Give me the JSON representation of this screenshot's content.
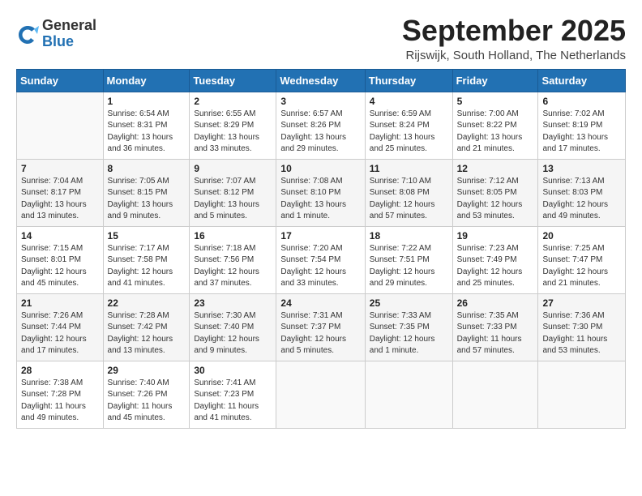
{
  "header": {
    "logo_general": "General",
    "logo_blue": "Blue",
    "month_title": "September 2025",
    "location": "Rijswijk, South Holland, The Netherlands"
  },
  "days_of_week": [
    "Sunday",
    "Monday",
    "Tuesday",
    "Wednesday",
    "Thursday",
    "Friday",
    "Saturday"
  ],
  "weeks": [
    [
      {
        "day": "",
        "info": ""
      },
      {
        "day": "1",
        "info": "Sunrise: 6:54 AM\nSunset: 8:31 PM\nDaylight: 13 hours\nand 36 minutes."
      },
      {
        "day": "2",
        "info": "Sunrise: 6:55 AM\nSunset: 8:29 PM\nDaylight: 13 hours\nand 33 minutes."
      },
      {
        "day": "3",
        "info": "Sunrise: 6:57 AM\nSunset: 8:26 PM\nDaylight: 13 hours\nand 29 minutes."
      },
      {
        "day": "4",
        "info": "Sunrise: 6:59 AM\nSunset: 8:24 PM\nDaylight: 13 hours\nand 25 minutes."
      },
      {
        "day": "5",
        "info": "Sunrise: 7:00 AM\nSunset: 8:22 PM\nDaylight: 13 hours\nand 21 minutes."
      },
      {
        "day": "6",
        "info": "Sunrise: 7:02 AM\nSunset: 8:19 PM\nDaylight: 13 hours\nand 17 minutes."
      }
    ],
    [
      {
        "day": "7",
        "info": "Sunrise: 7:04 AM\nSunset: 8:17 PM\nDaylight: 13 hours\nand 13 minutes."
      },
      {
        "day": "8",
        "info": "Sunrise: 7:05 AM\nSunset: 8:15 PM\nDaylight: 13 hours\nand 9 minutes."
      },
      {
        "day": "9",
        "info": "Sunrise: 7:07 AM\nSunset: 8:12 PM\nDaylight: 13 hours\nand 5 minutes."
      },
      {
        "day": "10",
        "info": "Sunrise: 7:08 AM\nSunset: 8:10 PM\nDaylight: 13 hours\nand 1 minute."
      },
      {
        "day": "11",
        "info": "Sunrise: 7:10 AM\nSunset: 8:08 PM\nDaylight: 12 hours\nand 57 minutes."
      },
      {
        "day": "12",
        "info": "Sunrise: 7:12 AM\nSunset: 8:05 PM\nDaylight: 12 hours\nand 53 minutes."
      },
      {
        "day": "13",
        "info": "Sunrise: 7:13 AM\nSunset: 8:03 PM\nDaylight: 12 hours\nand 49 minutes."
      }
    ],
    [
      {
        "day": "14",
        "info": "Sunrise: 7:15 AM\nSunset: 8:01 PM\nDaylight: 12 hours\nand 45 minutes."
      },
      {
        "day": "15",
        "info": "Sunrise: 7:17 AM\nSunset: 7:58 PM\nDaylight: 12 hours\nand 41 minutes."
      },
      {
        "day": "16",
        "info": "Sunrise: 7:18 AM\nSunset: 7:56 PM\nDaylight: 12 hours\nand 37 minutes."
      },
      {
        "day": "17",
        "info": "Sunrise: 7:20 AM\nSunset: 7:54 PM\nDaylight: 12 hours\nand 33 minutes."
      },
      {
        "day": "18",
        "info": "Sunrise: 7:22 AM\nSunset: 7:51 PM\nDaylight: 12 hours\nand 29 minutes."
      },
      {
        "day": "19",
        "info": "Sunrise: 7:23 AM\nSunset: 7:49 PM\nDaylight: 12 hours\nand 25 minutes."
      },
      {
        "day": "20",
        "info": "Sunrise: 7:25 AM\nSunset: 7:47 PM\nDaylight: 12 hours\nand 21 minutes."
      }
    ],
    [
      {
        "day": "21",
        "info": "Sunrise: 7:26 AM\nSunset: 7:44 PM\nDaylight: 12 hours\nand 17 minutes."
      },
      {
        "day": "22",
        "info": "Sunrise: 7:28 AM\nSunset: 7:42 PM\nDaylight: 12 hours\nand 13 minutes."
      },
      {
        "day": "23",
        "info": "Sunrise: 7:30 AM\nSunset: 7:40 PM\nDaylight: 12 hours\nand 9 minutes."
      },
      {
        "day": "24",
        "info": "Sunrise: 7:31 AM\nSunset: 7:37 PM\nDaylight: 12 hours\nand 5 minutes."
      },
      {
        "day": "25",
        "info": "Sunrise: 7:33 AM\nSunset: 7:35 PM\nDaylight: 12 hours\nand 1 minute."
      },
      {
        "day": "26",
        "info": "Sunrise: 7:35 AM\nSunset: 7:33 PM\nDaylight: 11 hours\nand 57 minutes."
      },
      {
        "day": "27",
        "info": "Sunrise: 7:36 AM\nSunset: 7:30 PM\nDaylight: 11 hours\nand 53 minutes."
      }
    ],
    [
      {
        "day": "28",
        "info": "Sunrise: 7:38 AM\nSunset: 7:28 PM\nDaylight: 11 hours\nand 49 minutes."
      },
      {
        "day": "29",
        "info": "Sunrise: 7:40 AM\nSunset: 7:26 PM\nDaylight: 11 hours\nand 45 minutes."
      },
      {
        "day": "30",
        "info": "Sunrise: 7:41 AM\nSunset: 7:23 PM\nDaylight: 11 hours\nand 41 minutes."
      },
      {
        "day": "",
        "info": ""
      },
      {
        "day": "",
        "info": ""
      },
      {
        "day": "",
        "info": ""
      },
      {
        "day": "",
        "info": ""
      }
    ]
  ]
}
